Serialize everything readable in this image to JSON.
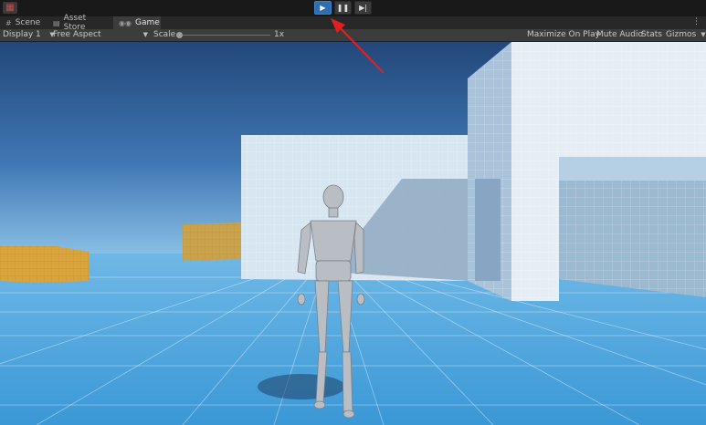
{
  "toolbar": {
    "app_icon": "unity-grid-icon",
    "play": "▶",
    "pause": "❚❚",
    "step": "▶|"
  },
  "tabs": [
    {
      "label": "Scene",
      "icon": "#"
    },
    {
      "label": "Asset Store",
      "icon": "▤"
    },
    {
      "label": "Game",
      "icon": "◉◉"
    }
  ],
  "game_bar": {
    "display": "Display 1",
    "aspect": "Free Aspect",
    "scale_label": "Scale",
    "scale_value": "1x",
    "maximize": "Maximize On Play",
    "mute": "Mute Audio",
    "stats": "Stats",
    "gizmos": "Gizmos"
  },
  "menu_glyph": "⋮",
  "colors": {
    "play_active": "#2d6db2",
    "annotation_arrow": "#e02020",
    "sky_top": "#244a7c",
    "floor": "#4fa3dc"
  }
}
